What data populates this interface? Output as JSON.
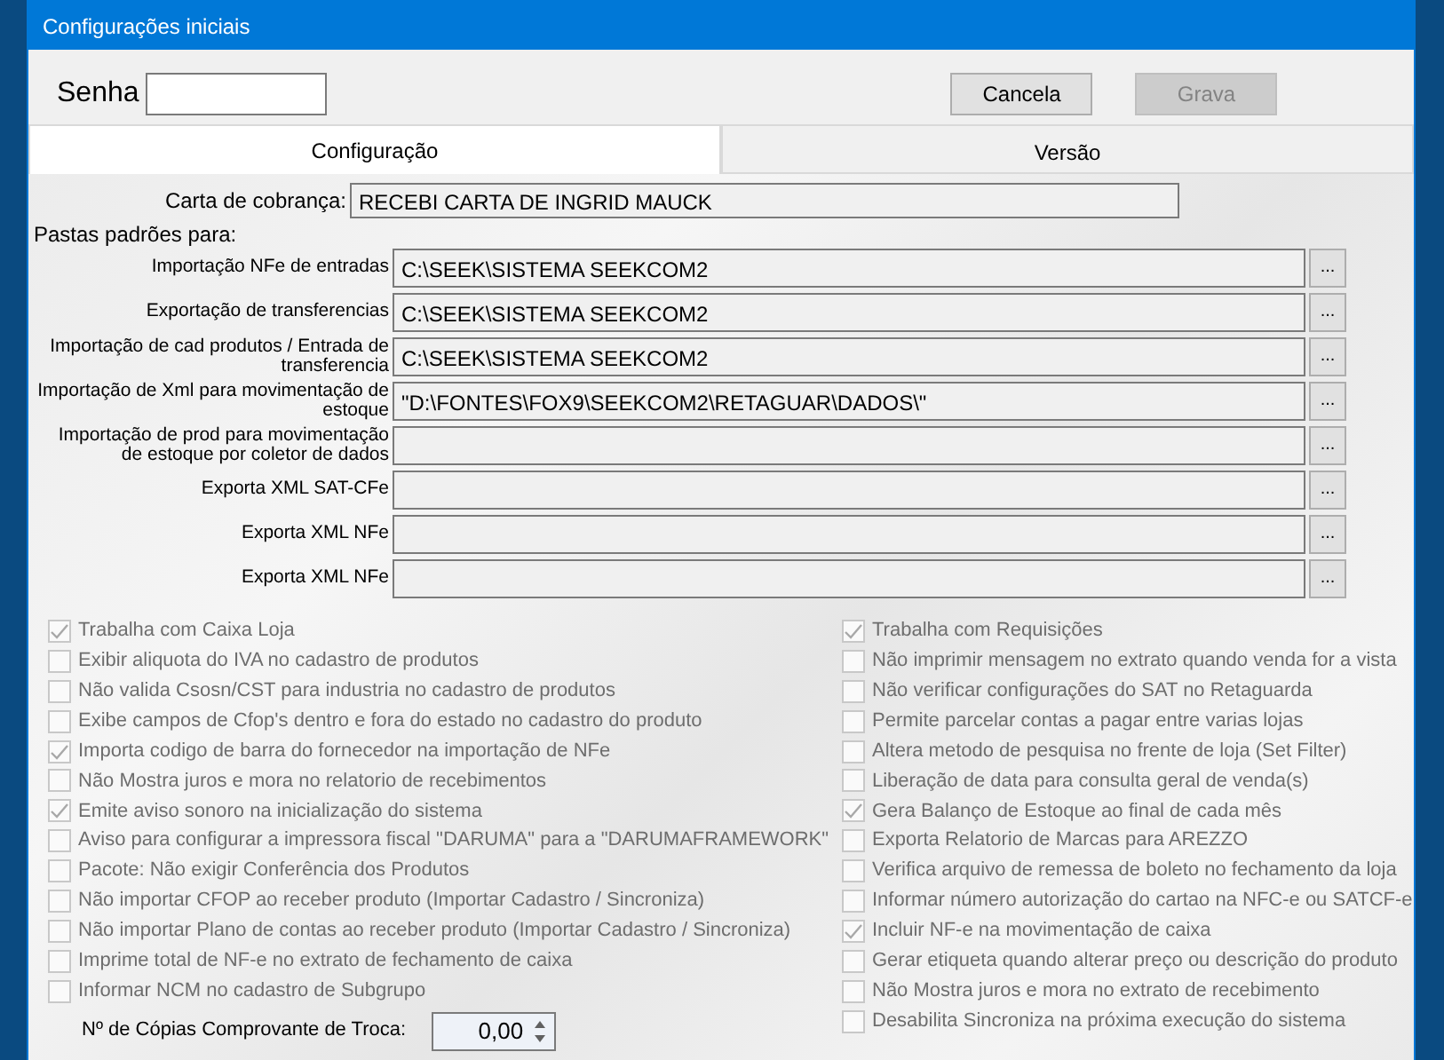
{
  "window": {
    "title": "Configurações iniciais"
  },
  "password": {
    "label": "Senha"
  },
  "buttons": [
    {
      "label": "Cancela",
      "disabled": false
    },
    {
      "label": "Grava",
      "disabled": true
    }
  ],
  "tabs": [
    {
      "label": "Configuração",
      "selected": true
    },
    {
      "label": "Versão",
      "selected": false
    }
  ],
  "billing_letter": {
    "label": "Carta de cobrança:",
    "value": "RECEBI CARTA DE INGRID MAUCK"
  },
  "folders_heading": "Pastas padrões para:",
  "folders": [
    {
      "label": "Importação NFe de entradas",
      "value": "C:\\SEEK\\SISTEMA SEEKCOM2",
      "browse": "..."
    },
    {
      "label": "Exportação de transferencias",
      "value": "C:\\SEEK\\SISTEMA SEEKCOM2",
      "browse": "..."
    },
    {
      "label": "Importação de cad produtos / Entrada de transferencia",
      "value": "C:\\SEEK\\SISTEMA SEEKCOM2",
      "browse": "..."
    },
    {
      "label": "Importação de Xml para movimentação de estoque",
      "value": "\"D:\\FONTES\\FOX9\\SEEKCOM2\\RETAGUAR\\DADOS\\\"",
      "browse": "..."
    },
    {
      "label": "Importação de prod para movimentação de estoque por coletor de dados",
      "browse": "..."
    },
    {
      "label": "Exporta XML SAT-CFe",
      "browse": "..."
    },
    {
      "label": "Exporta XML NFe",
      "browse": "..."
    },
    {
      "label": "Exporta XML NFe",
      "browse": "..."
    }
  ],
  "options_left": [
    {
      "label": "Trabalha com Caixa Loja",
      "checked": true,
      "disabled": true
    },
    {
      "label": "Exibir aliquota do IVA no cadastro de produtos",
      "checked": false,
      "disabled": true
    },
    {
      "label": "Não valida Csosn/CST para industria no cadastro de produtos",
      "checked": false,
      "disabled": true
    },
    {
      "label": "Exibe campos de Cfop's dentro e fora do estado no cadastro do produto",
      "checked": false,
      "disabled": true
    },
    {
      "label": "Importa codigo de barra do fornecedor na importação de NFe",
      "checked": true,
      "disabled": true
    },
    {
      "label": "Não Mostra juros e mora no relatorio de recebimentos",
      "checked": false,
      "disabled": true
    },
    {
      "label": "Emite aviso sonoro na inicialização do sistema",
      "checked": true,
      "disabled": true
    },
    {
      "label": "Aviso para configurar a impressora fiscal \"DARUMA\" para a \"DARUMAFRAMEWORK\"",
      "checked": false,
      "disabled": true
    },
    {
      "label": "Pacote: Não exigir Conferência dos Produtos",
      "checked": false,
      "disabled": true
    },
    {
      "label": "Não importar CFOP ao receber produto (Importar Cadastro / Sincroniza)",
      "checked": false,
      "disabled": true
    },
    {
      "label": "Não importar Plano de contas ao receber produto (Importar Cadastro / Sincroniza)",
      "checked": false,
      "disabled": true
    },
    {
      "label": "Imprime total de NF-e no extrato de fechamento de caixa",
      "checked": false,
      "disabled": true
    },
    {
      "label": "Informar NCM no cadastro de Subgrupo",
      "checked": false,
      "disabled": true
    }
  ],
  "options_right": [
    {
      "label": "Trabalha com Requisições",
      "checked": true,
      "disabled": true
    },
    {
      "label": "Não imprimir mensagem no extrato quando venda for a vista",
      "checked": false,
      "disabled": true
    },
    {
      "label": "Não verificar configurações do SAT no Retaguarda",
      "checked": false,
      "disabled": true
    },
    {
      "label": "Permite parcelar contas a pagar entre varias lojas",
      "checked": false,
      "disabled": true
    },
    {
      "label": "Altera metodo de pesquisa no frente de loja (Set Filter)",
      "checked": false,
      "disabled": true
    },
    {
      "label": "Liberação de data para consulta geral de venda(s)",
      "checked": false,
      "disabled": true
    },
    {
      "label": "Gera Balanço de Estoque ao final de cada mês",
      "checked": true,
      "disabled": true
    },
    {
      "label": "Exporta Relatorio de Marcas para AREZZO",
      "checked": false,
      "disabled": true
    },
    {
      "label": "Verifica arquivo de remessa de boleto no fechamento da loja",
      "checked": false,
      "disabled": true
    },
    {
      "label": "Informar número autorização do cartao na NFC-e ou SATCF-e",
      "checked": false,
      "disabled": true
    },
    {
      "label": "Incluir NF-e na movimentação de caixa",
      "checked": true,
      "disabled": true
    },
    {
      "label": "Gerar etiqueta quando alterar preço ou descrição do produto",
      "checked": false,
      "disabled": true
    },
    {
      "label": "Não Mostra juros e mora no extrato de recebimento",
      "checked": false,
      "disabled": true
    },
    {
      "label": "Desabilita Sincroniza na próxima execução do sistema",
      "checked": false,
      "disabled": true
    }
  ],
  "copies": {
    "label": "Nº de Cópias Comprovante de Troca:",
    "value": "0,00"
  }
}
